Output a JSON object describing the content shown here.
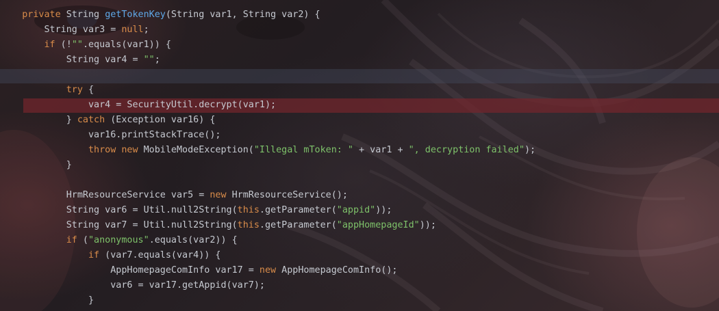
{
  "theme": {
    "keyword_color": "#d98c4a",
    "function_color": "#5fa8e8",
    "string_color": "#7ec26a",
    "text_color": "#c6cad1",
    "breakpoint_line_color": "#73262c",
    "caret_line_color": "#464e64"
  },
  "editor": {
    "lines": [
      [
        {
          "t": "    ",
          "k": "pl"
        },
        {
          "t": "private",
          "k": "kw"
        },
        {
          "t": " String ",
          "k": "pl"
        },
        {
          "t": "getTokenKey",
          "k": "fn"
        },
        {
          "t": "(String var1, String var2) {",
          "k": "pl"
        }
      ],
      [
        {
          "t": "        String var3 = ",
          "k": "pl"
        },
        {
          "t": "null",
          "k": "kw"
        },
        {
          "t": ";",
          "k": "pl"
        }
      ],
      [
        {
          "t": "        ",
          "k": "pl"
        },
        {
          "t": "if",
          "k": "kw"
        },
        {
          "t": " (!",
          "k": "pl"
        },
        {
          "t": "\"\"",
          "k": "str"
        },
        {
          "t": ".equals(var1)) {",
          "k": "pl"
        }
      ],
      [
        {
          "t": "            String var4 = ",
          "k": "pl"
        },
        {
          "t": "\"\"",
          "k": "str"
        },
        {
          "t": ";",
          "k": "pl"
        }
      ],
      [
        {
          "t": "",
          "k": "pl"
        }
      ],
      [
        {
          "t": "            ",
          "k": "pl"
        },
        {
          "t": "try",
          "k": "kw"
        },
        {
          "t": " {",
          "k": "pl"
        }
      ],
      [
        {
          "t": "                var4 = SecurityUtil.decrypt(var1);",
          "k": "pl"
        }
      ],
      [
        {
          "t": "            } ",
          "k": "pl"
        },
        {
          "t": "catch",
          "k": "kw"
        },
        {
          "t": " (Exception var16) {",
          "k": "pl"
        }
      ],
      [
        {
          "t": "                var16.printStackTrace();",
          "k": "pl"
        }
      ],
      [
        {
          "t": "                ",
          "k": "pl"
        },
        {
          "t": "throw new",
          "k": "kw"
        },
        {
          "t": " MobileModeException(",
          "k": "pl"
        },
        {
          "t": "\"Illegal mToken: \"",
          "k": "str"
        },
        {
          "t": " + var1 + ",
          "k": "pl"
        },
        {
          "t": "\", decryption failed\"",
          "k": "str"
        },
        {
          "t": ");",
          "k": "pl"
        }
      ],
      [
        {
          "t": "            }",
          "k": "pl"
        }
      ],
      [
        {
          "t": "",
          "k": "pl"
        }
      ],
      [
        {
          "t": "            HrmResourceService var5 = ",
          "k": "pl"
        },
        {
          "t": "new",
          "k": "kw"
        },
        {
          "t": " HrmResourceService();",
          "k": "pl"
        }
      ],
      [
        {
          "t": "            String var6 = Util.null2String(",
          "k": "pl"
        },
        {
          "t": "this",
          "k": "kw"
        },
        {
          "t": ".getParameter(",
          "k": "pl"
        },
        {
          "t": "\"appid\"",
          "k": "str"
        },
        {
          "t": "));",
          "k": "pl"
        }
      ],
      [
        {
          "t": "            String var7 = Util.null2String(",
          "k": "pl"
        },
        {
          "t": "this",
          "k": "kw"
        },
        {
          "t": ".getParameter(",
          "k": "pl"
        },
        {
          "t": "\"appHomepageId\"",
          "k": "str"
        },
        {
          "t": "));",
          "k": "pl"
        }
      ],
      [
        {
          "t": "            ",
          "k": "pl"
        },
        {
          "t": "if",
          "k": "kw"
        },
        {
          "t": " (",
          "k": "pl"
        },
        {
          "t": "\"anonymous\"",
          "k": "str"
        },
        {
          "t": ".equals(var2)) {",
          "k": "pl"
        }
      ],
      [
        {
          "t": "                ",
          "k": "pl"
        },
        {
          "t": "if",
          "k": "kw"
        },
        {
          "t": " (var7.equals(var4)) {",
          "k": "pl"
        }
      ],
      [
        {
          "t": "                    AppHomepageComInfo var17 = ",
          "k": "pl"
        },
        {
          "t": "new",
          "k": "kw"
        },
        {
          "t": " AppHomepageComInfo();",
          "k": "pl"
        }
      ],
      [
        {
          "t": "                    var6 = var17.getAppid(var7);",
          "k": "pl"
        }
      ],
      [
        {
          "t": "                }",
          "k": "pl"
        }
      ]
    ]
  }
}
